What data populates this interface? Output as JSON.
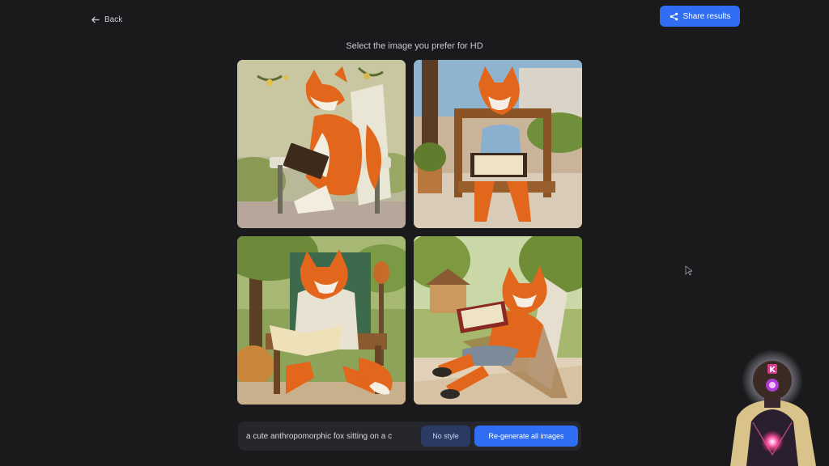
{
  "header": {
    "back_label": "Back",
    "share_label": "Share results"
  },
  "main": {
    "title": "Select the image you prefer for HD"
  },
  "prompt_bar": {
    "prompt_value": "a cute anthropomorphic fox sitting on a c",
    "style_label": "No style",
    "regenerate_label": "Re-generate all images"
  },
  "overlay": {
    "avatar_badge": "K"
  },
  "colors": {
    "background": "#1a1a1c",
    "accent": "#2f6df3",
    "style_button": "#2b3a63",
    "fox_orange": "#e2661c"
  }
}
